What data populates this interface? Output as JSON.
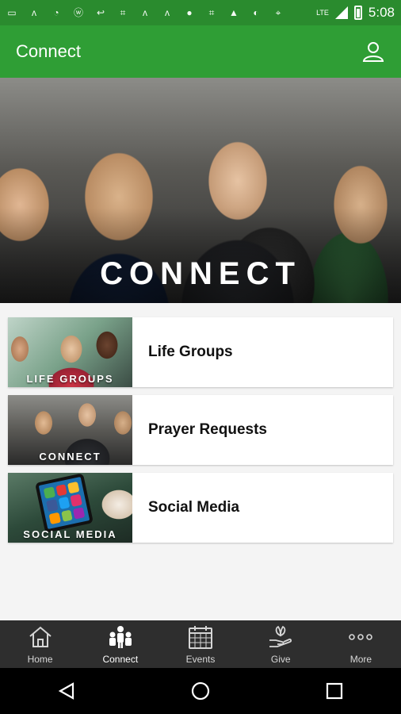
{
  "status_bar": {
    "time": "5:08",
    "icons": [
      "chat-icon",
      "signal-a-icon",
      "sync-icon",
      "wordpress-icon",
      "arrow-icon",
      "hash-icon",
      "signal-a-icon",
      "signal-a-icon",
      "circle-icon",
      "hash-icon",
      "warning-icon",
      "chat-icon",
      "location-icon"
    ],
    "network": "LTE"
  },
  "app_bar": {
    "title": "Connect",
    "color": "#2f9e35"
  },
  "hero": {
    "title": "CONNECT"
  },
  "list": [
    {
      "label": "Life Groups",
      "thumb_caption": "LIFE GROUPS"
    },
    {
      "label": "Prayer Requests",
      "thumb_caption": "CONNECT"
    },
    {
      "label": "Social Media",
      "thumb_caption": "SOCIAL MEDIA"
    }
  ],
  "bottom_nav": [
    {
      "label": "Home",
      "icon": "home-icon",
      "active": false
    },
    {
      "label": "Connect",
      "icon": "people-icon",
      "active": true
    },
    {
      "label": "Events",
      "icon": "calendar-icon",
      "active": false
    },
    {
      "label": "Give",
      "icon": "give-icon",
      "active": false
    },
    {
      "label": "More",
      "icon": "more-icon",
      "active": false
    }
  ]
}
